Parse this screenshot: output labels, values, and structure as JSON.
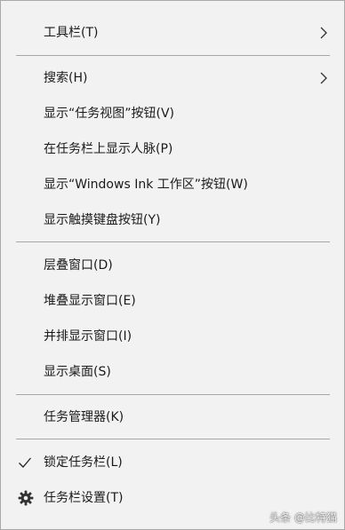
{
  "menu": {
    "toolbars": "工具栏(T)",
    "search": "搜索(H)",
    "show_task_view": "显示“任务视图”按钮(V)",
    "show_people": "在任务栏上显示人脉(P)",
    "show_ink_workspace": "显示“Windows Ink 工作区”按钮(W)",
    "show_touch_keyboard": "显示触摸键盘按钮(Y)",
    "cascade": "层叠窗口(D)",
    "stack": "堆叠显示窗口(E)",
    "side_by_side": "并排显示窗口(I)",
    "show_desktop": "显示桌面(S)",
    "task_manager": "任务管理器(K)",
    "lock_taskbar": "锁定任务栏(L)",
    "taskbar_settings": "任务栏设置(T)"
  },
  "state": {
    "lock_taskbar_checked": true
  },
  "icons": {
    "submenu": "chevron-right-icon",
    "checked": "checkmark-icon",
    "settings": "gear-icon"
  },
  "watermark": "头条 @比特猫"
}
